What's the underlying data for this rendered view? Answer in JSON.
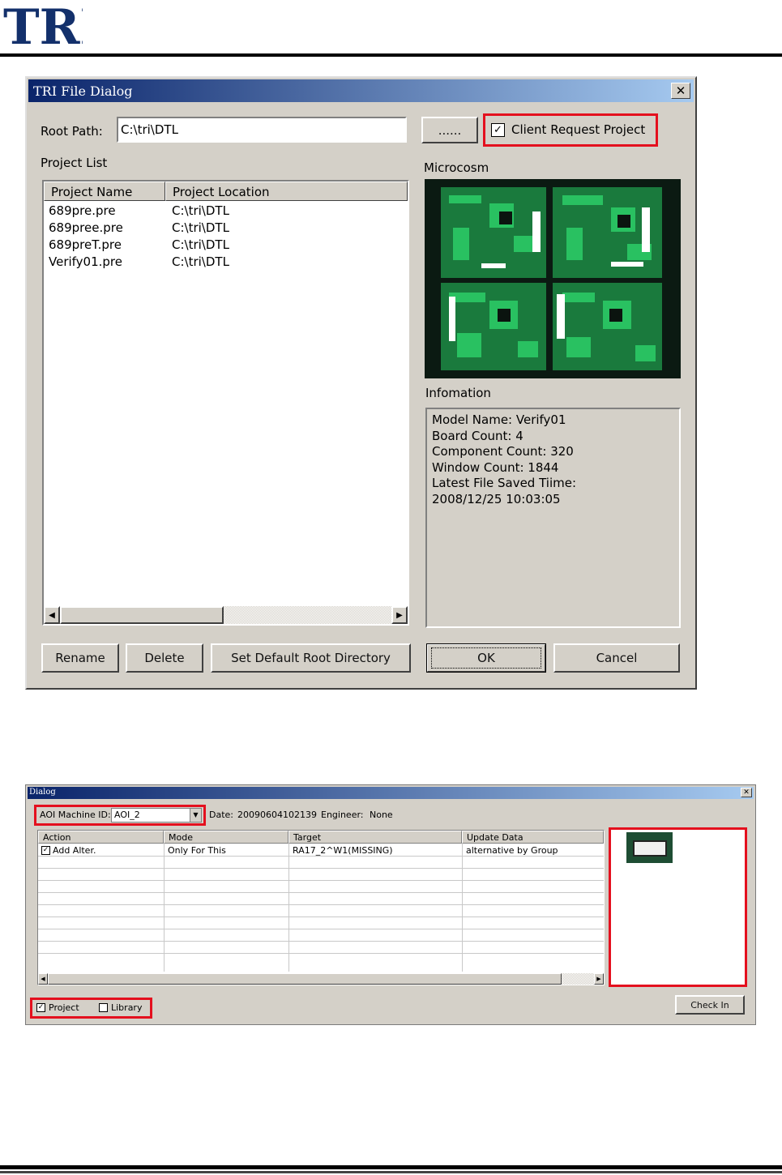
{
  "header": {
    "logo_text": "TRI"
  },
  "dialog1": {
    "title": "TRI File Dialog",
    "close_glyph": "✕",
    "root_path_label": "Root Path:",
    "root_path_value": "C:\\tri\\DTL",
    "browse_label": "......",
    "client_request": {
      "label": "Client Request Project",
      "checked": true
    },
    "project_list_label": "Project List",
    "columns": [
      "Project Name",
      "Project Location"
    ],
    "projects": [
      {
        "name": "689pre.pre",
        "location": "C:\\tri\\DTL"
      },
      {
        "name": "689pree.pre",
        "location": "C:\\tri\\DTL"
      },
      {
        "name": "689preT.pre",
        "location": "C:\\tri\\DTL"
      },
      {
        "name": "Verify01.pre",
        "location": "C:\\tri\\DTL"
      }
    ],
    "microcosm_label": "Microcosm",
    "info_label": "Infomation",
    "info_lines": [
      "Model Name: Verify01",
      "Board Count: 4",
      "Component Count: 320",
      "Window Count: 1844",
      "Latest File Saved Tiime:",
      "2008/12/25  10:03:05"
    ],
    "buttons": {
      "rename": "Rename",
      "delete": "Delete",
      "set_default": "Set Default Root Directory",
      "ok": "OK",
      "cancel": "Cancel"
    }
  },
  "dialog2": {
    "title": "Dialog",
    "close_glyph": "✕",
    "aoi_label": "AOI Machine ID:",
    "aoi_value": "AOI_2",
    "date_label": "Date:",
    "date_value": "20090604102139",
    "engineer_label": "Engineer:",
    "engineer_value": "None",
    "columns": [
      "Action",
      "Mode",
      "Target",
      "Update Data"
    ],
    "rows": [
      {
        "action": "Add Alter.",
        "checked": true,
        "mode": "Only For This",
        "target": "RA17_2^W1(MISSING)",
        "update": "alternative by Group"
      }
    ],
    "project_check": {
      "label": "Project",
      "checked": true
    },
    "library_check": {
      "label": "Library",
      "checked": false
    },
    "check_in": "Check In"
  },
  "colors": {
    "highlight": "#e4101e",
    "titlebar": "#0a246a",
    "pcb_green": "#1fae54"
  }
}
